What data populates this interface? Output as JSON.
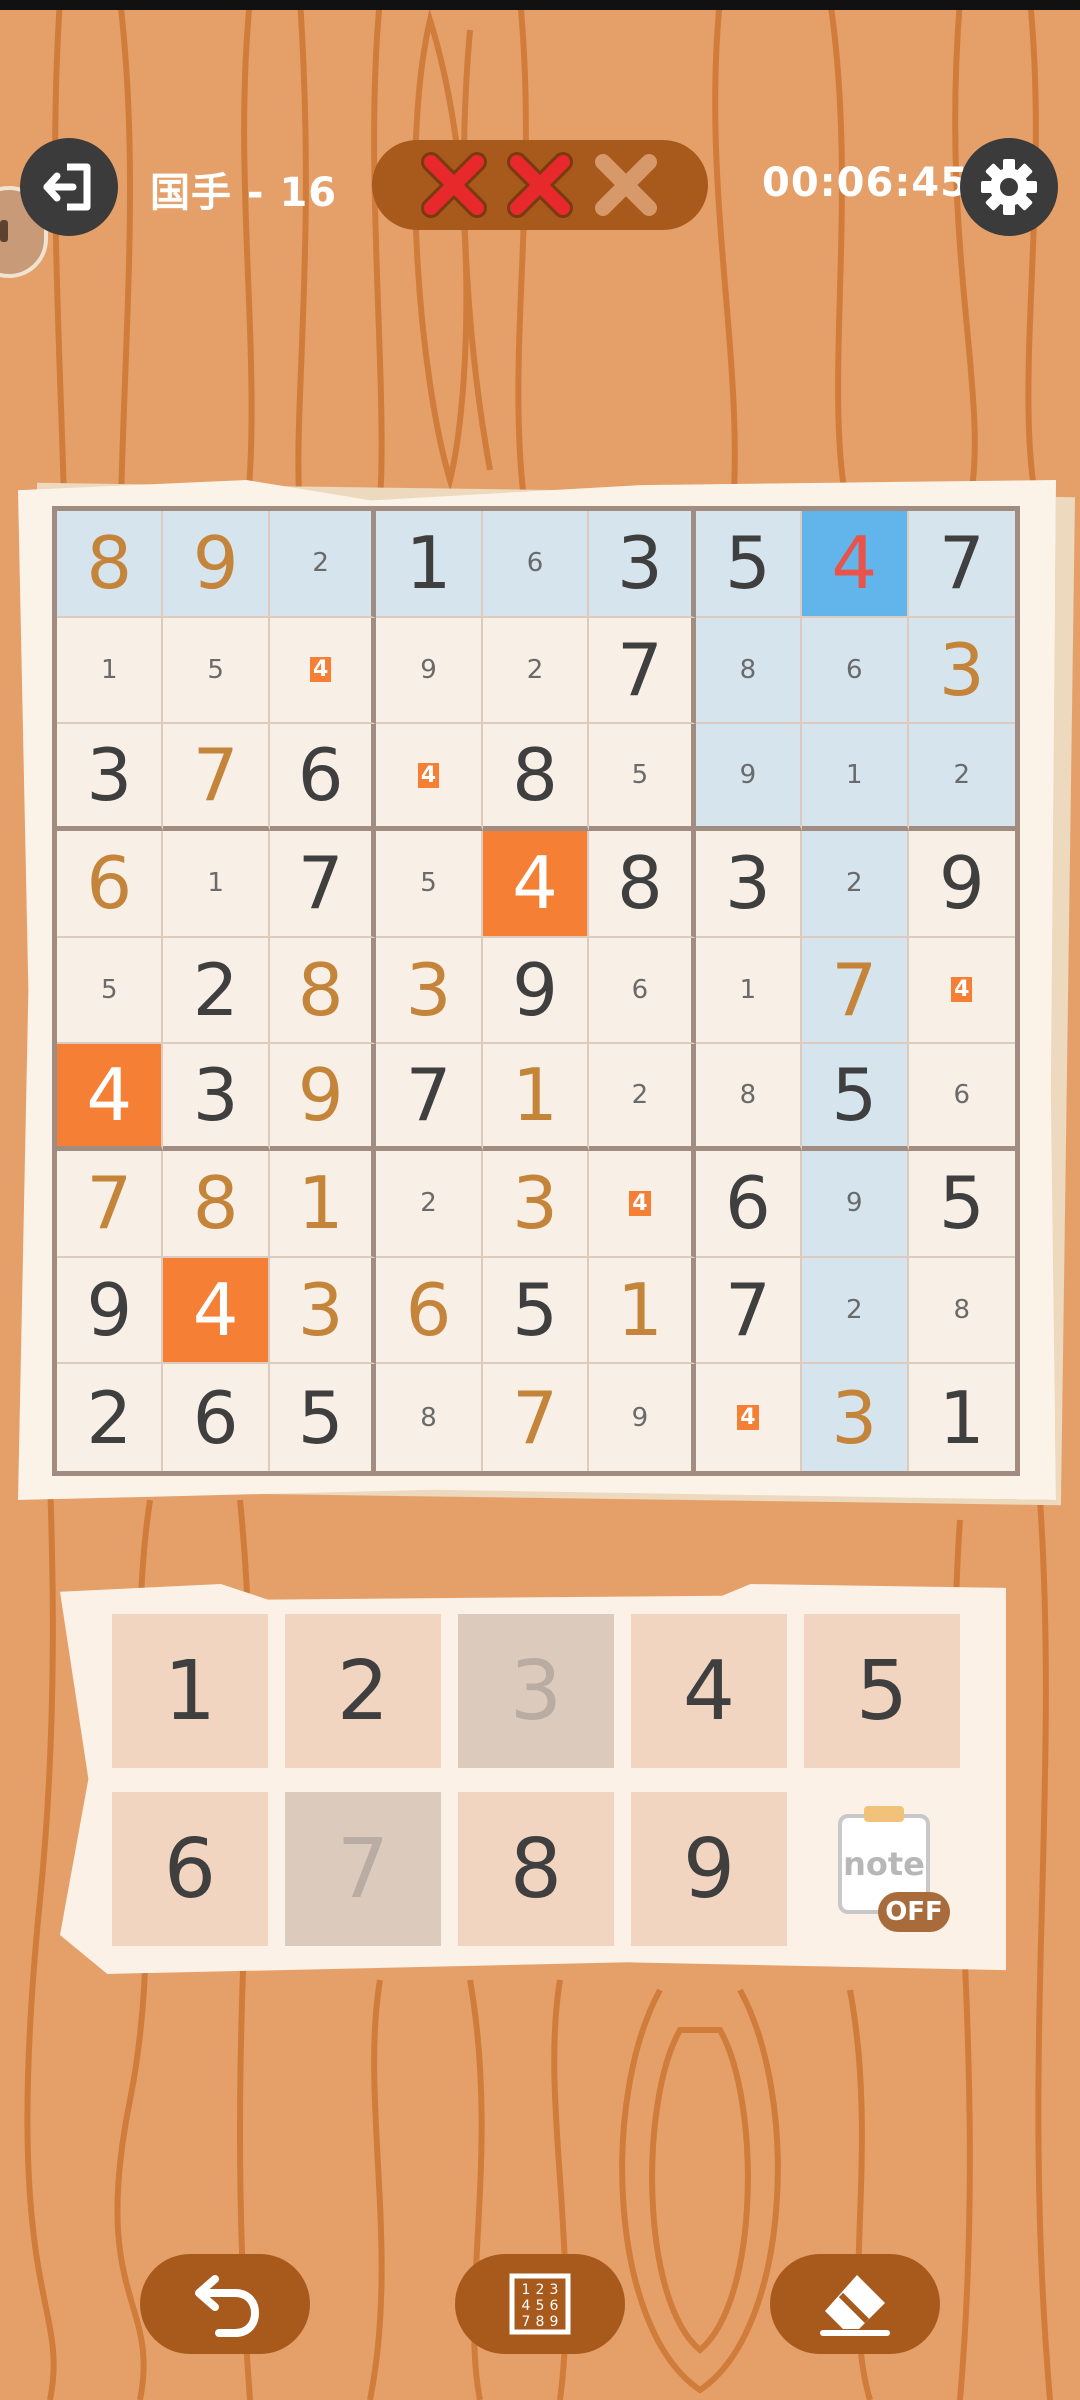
{
  "header": {
    "level_label": "国手 - 16",
    "timer": "00:06:45",
    "mistakes_made": 2,
    "mistakes_max": 3
  },
  "colors": {
    "background": "#e5a06a",
    "accent_brown": "#a85a1c",
    "selected_cell": "#62b5ea",
    "highlight_cell": "#d6e4ee",
    "same_number_cell": "#f47f35",
    "error_text": "#e8544b",
    "user_text": "#c4843a",
    "given_text": "#3f3f3f"
  },
  "board": {
    "selected": [
      0,
      7
    ],
    "rows": [
      [
        {
          "v": "8",
          "t": "user",
          "bg": "hl"
        },
        {
          "v": "9",
          "t": "user",
          "bg": "hl"
        },
        {
          "v": "2",
          "t": "small",
          "bg": "hl"
        },
        {
          "v": "1",
          "t": "given",
          "bg": "hl"
        },
        {
          "v": "6",
          "t": "small",
          "bg": "hl"
        },
        {
          "v": "3",
          "t": "given",
          "bg": "hl"
        },
        {
          "v": "5",
          "t": "given",
          "bg": "hl"
        },
        {
          "v": "4",
          "t": "err",
          "bg": "sel"
        },
        {
          "v": "7",
          "t": "given",
          "bg": "hl"
        }
      ],
      [
        {
          "v": "1",
          "t": "small",
          "bg": ""
        },
        {
          "v": "5",
          "t": "small",
          "bg": ""
        },
        {
          "v": "4",
          "t": "small-orange",
          "bg": ""
        },
        {
          "v": "9",
          "t": "small",
          "bg": ""
        },
        {
          "v": "2",
          "t": "small",
          "bg": ""
        },
        {
          "v": "7",
          "t": "given",
          "bg": ""
        },
        {
          "v": "8",
          "t": "small",
          "bg": "hl"
        },
        {
          "v": "6",
          "t": "small",
          "bg": "hl"
        },
        {
          "v": "3",
          "t": "user",
          "bg": "hl"
        }
      ],
      [
        {
          "v": "3",
          "t": "given",
          "bg": ""
        },
        {
          "v": "7",
          "t": "user",
          "bg": ""
        },
        {
          "v": "6",
          "t": "given",
          "bg": ""
        },
        {
          "v": "4",
          "t": "small-orange",
          "bg": ""
        },
        {
          "v": "8",
          "t": "given",
          "bg": ""
        },
        {
          "v": "5",
          "t": "small",
          "bg": ""
        },
        {
          "v": "9",
          "t": "small",
          "bg": "hl"
        },
        {
          "v": "1",
          "t": "small",
          "bg": "hl"
        },
        {
          "v": "2",
          "t": "small",
          "bg": "hl"
        }
      ],
      [
        {
          "v": "6",
          "t": "user",
          "bg": ""
        },
        {
          "v": "1",
          "t": "small",
          "bg": ""
        },
        {
          "v": "7",
          "t": "given",
          "bg": ""
        },
        {
          "v": "5",
          "t": "small",
          "bg": ""
        },
        {
          "v": "4",
          "t": "given",
          "bg": "same"
        },
        {
          "v": "8",
          "t": "given",
          "bg": ""
        },
        {
          "v": "3",
          "t": "given",
          "bg": ""
        },
        {
          "v": "2",
          "t": "small",
          "bg": "hl"
        },
        {
          "v": "9",
          "t": "given",
          "bg": ""
        }
      ],
      [
        {
          "v": "5",
          "t": "small",
          "bg": ""
        },
        {
          "v": "2",
          "t": "given",
          "bg": ""
        },
        {
          "v": "8",
          "t": "user",
          "bg": ""
        },
        {
          "v": "3",
          "t": "user",
          "bg": ""
        },
        {
          "v": "9",
          "t": "given",
          "bg": ""
        },
        {
          "v": "6",
          "t": "small",
          "bg": ""
        },
        {
          "v": "1",
          "t": "small",
          "bg": ""
        },
        {
          "v": "7",
          "t": "user",
          "bg": "hl"
        },
        {
          "v": "4",
          "t": "small-orange",
          "bg": ""
        }
      ],
      [
        {
          "v": "4",
          "t": "given",
          "bg": "same"
        },
        {
          "v": "3",
          "t": "given",
          "bg": ""
        },
        {
          "v": "9",
          "t": "user",
          "bg": ""
        },
        {
          "v": "7",
          "t": "given",
          "bg": ""
        },
        {
          "v": "1",
          "t": "user",
          "bg": ""
        },
        {
          "v": "2",
          "t": "small",
          "bg": ""
        },
        {
          "v": "8",
          "t": "small",
          "bg": ""
        },
        {
          "v": "5",
          "t": "given",
          "bg": "hl"
        },
        {
          "v": "6",
          "t": "small",
          "bg": ""
        }
      ],
      [
        {
          "v": "7",
          "t": "user",
          "bg": ""
        },
        {
          "v": "8",
          "t": "user",
          "bg": ""
        },
        {
          "v": "1",
          "t": "user",
          "bg": ""
        },
        {
          "v": "2",
          "t": "small",
          "bg": ""
        },
        {
          "v": "3",
          "t": "user",
          "bg": ""
        },
        {
          "v": "4",
          "t": "small-orange",
          "bg": ""
        },
        {
          "v": "6",
          "t": "given",
          "bg": ""
        },
        {
          "v": "9",
          "t": "small",
          "bg": "hl"
        },
        {
          "v": "5",
          "t": "given",
          "bg": ""
        }
      ],
      [
        {
          "v": "9",
          "t": "given",
          "bg": ""
        },
        {
          "v": "4",
          "t": "given",
          "bg": "same"
        },
        {
          "v": "3",
          "t": "user",
          "bg": ""
        },
        {
          "v": "6",
          "t": "user",
          "bg": ""
        },
        {
          "v": "5",
          "t": "given",
          "bg": ""
        },
        {
          "v": "1",
          "t": "user",
          "bg": ""
        },
        {
          "v": "7",
          "t": "given",
          "bg": ""
        },
        {
          "v": "2",
          "t": "small",
          "bg": "hl"
        },
        {
          "v": "8",
          "t": "small",
          "bg": ""
        }
      ],
      [
        {
          "v": "2",
          "t": "given",
          "bg": ""
        },
        {
          "v": "6",
          "t": "given",
          "bg": ""
        },
        {
          "v": "5",
          "t": "given",
          "bg": ""
        },
        {
          "v": "8",
          "t": "small",
          "bg": ""
        },
        {
          "v": "7",
          "t": "user",
          "bg": ""
        },
        {
          "v": "9",
          "t": "small",
          "bg": ""
        },
        {
          "v": "4",
          "t": "small-orange",
          "bg": ""
        },
        {
          "v": "3",
          "t": "user",
          "bg": "hl"
        },
        {
          "v": "1",
          "t": "given",
          "bg": ""
        }
      ]
    ]
  },
  "keypad": {
    "keys": [
      {
        "label": "1",
        "done": false
      },
      {
        "label": "2",
        "done": false
      },
      {
        "label": "3",
        "done": true
      },
      {
        "label": "4",
        "done": false
      },
      {
        "label": "5",
        "done": false
      },
      {
        "label": "6",
        "done": false
      },
      {
        "label": "7",
        "done": true
      },
      {
        "label": "8",
        "done": false
      },
      {
        "label": "9",
        "done": false
      }
    ],
    "note_label": "note",
    "note_state": "OFF"
  },
  "icons": {
    "exit": "exit-icon",
    "settings": "gear-icon",
    "undo": "undo-icon",
    "auto_notes": "number-grid-icon",
    "erase": "eraser-icon"
  }
}
